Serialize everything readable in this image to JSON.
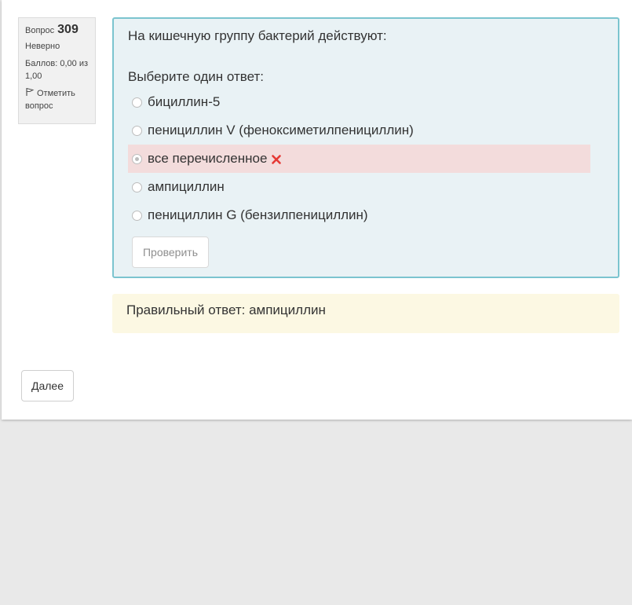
{
  "question_info": {
    "label": "Вопрос",
    "number": "309",
    "state": "Неверно",
    "grade": "Баллов: 0,00 из 1,00",
    "flag_label": "Отметить вопрос"
  },
  "question": {
    "text": "На кишечную группу бактерий действуют:",
    "prompt": "Выберите один ответ:",
    "options": [
      {
        "label": "бициллин-5",
        "checked": false,
        "incorrect": false
      },
      {
        "label": "пенициллин V (феноксиметилпенициллин)",
        "checked": false,
        "incorrect": false
      },
      {
        "label": "все перечисленное",
        "checked": true,
        "incorrect": true
      },
      {
        "label": "ампициллин",
        "checked": false,
        "incorrect": false
      },
      {
        "label": "пенициллин G (бензилпенициллин)",
        "checked": false,
        "incorrect": false
      }
    ],
    "check_label": "Проверить"
  },
  "feedback": {
    "right_answer": "Правильный ответ: ампициллин"
  },
  "navigation": {
    "next_label": "Далее"
  },
  "colors": {
    "incorrect_bg": "#f3dcdc",
    "formulation_bg": "#e9f2f5",
    "formulation_border": "#7bc4cf",
    "feedback_bg": "#fcf8e3",
    "incorrect_icon": "#e53935"
  }
}
